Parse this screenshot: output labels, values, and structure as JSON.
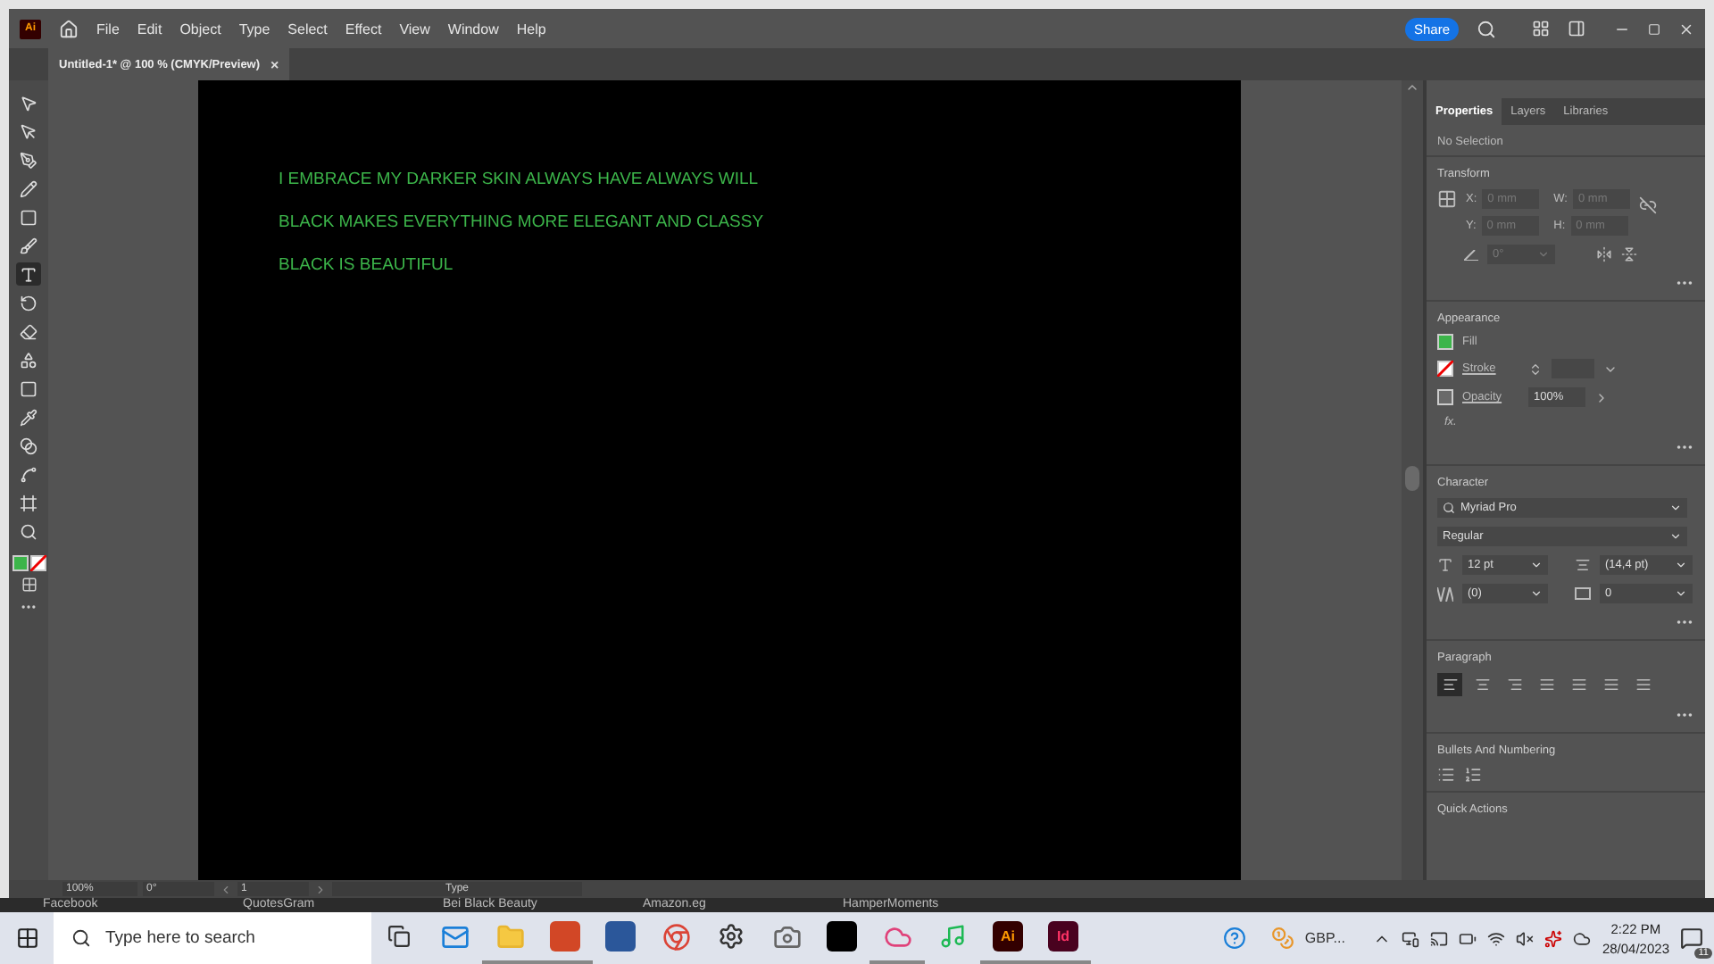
{
  "menu_bar": {
    "logo": "Ai",
    "items": [
      "File",
      "Edit",
      "Object",
      "Type",
      "Select",
      "Effect",
      "View",
      "Window",
      "Help"
    ],
    "share": "Share"
  },
  "document_tab": {
    "title": "Untitled-1* @ 100 % (CMYK/Preview)",
    "close": "×"
  },
  "tools": [
    {
      "kind": "selection",
      "selected": false
    },
    {
      "kind": "direct",
      "selected": false
    },
    {
      "kind": "pen",
      "selected": false
    },
    {
      "kind": "pencil",
      "selected": false
    },
    {
      "kind": "rectangle",
      "selected": false
    },
    {
      "kind": "brush",
      "selected": false
    },
    {
      "kind": "type",
      "selected": true
    },
    {
      "kind": "rotate",
      "selected": false
    },
    {
      "kind": "eraser",
      "selected": false
    },
    {
      "kind": "shape",
      "selected": false
    },
    {
      "kind": "gradient",
      "selected": false
    },
    {
      "kind": "eyedropper",
      "selected": false
    },
    {
      "kind": "blend",
      "selected": false
    },
    {
      "kind": "symbol",
      "selected": false
    },
    {
      "kind": "artboard",
      "selected": false
    },
    {
      "kind": "zoom",
      "selected": false
    }
  ],
  "toolbar_fill": {
    "color": "#3cb54a"
  },
  "artboard": {
    "lines": [
      "I EMBRACE MY DARKER SKIN ALWAYS HAVE ALWAYS WILL",
      "BLACK MAKES EVERYTHING MORE ELEGANT AND CLASSY",
      "BLACK IS BEAUTIFUL"
    ]
  },
  "status_bar": {
    "zoom": "100%",
    "rotation": "0°",
    "artboard": "1",
    "tool": "Type"
  },
  "bookmarks": [
    "Facebook",
    "QuotesGram",
    "Bei Black Beauty",
    "Amazon.eg",
    "HamperMoments"
  ],
  "panel": {
    "tabs": [
      {
        "label": "Properties",
        "selected": true
      },
      {
        "label": "Layers",
        "selected": false
      },
      {
        "label": "Libraries",
        "selected": false
      }
    ],
    "selection": "No Selection",
    "transform": {
      "title": "Transform",
      "fields": [
        {
          "label": "X:",
          "placeholder": "0 mm"
        },
        {
          "label": "W:",
          "placeholder": "0 mm"
        },
        {
          "label": "Y:",
          "placeholder": "0 mm"
        },
        {
          "label": "H:",
          "placeholder": "0 mm"
        }
      ],
      "angle_placeholder": "0°"
    },
    "appearance": {
      "title": "Appearance",
      "fill": {
        "label": "Fill",
        "color": "#3cb54a"
      },
      "stroke": {
        "label": "Stroke"
      },
      "opacity": {
        "label": "Opacity",
        "value": "100%"
      },
      "fx": "fx."
    },
    "character": {
      "title": "Character",
      "font": "Myriad Pro",
      "style": "Regular",
      "size": "12 pt",
      "leading": "(14,4 pt)",
      "kerning": "(0)",
      "tracking": "0"
    },
    "paragraph": {
      "title": "Paragraph",
      "alignments": [
        {
          "selected": true
        },
        {
          "selected": false
        },
        {
          "selected": false
        },
        {
          "selected": false
        },
        {
          "selected": false
        },
        {
          "selected": false
        },
        {
          "selected": false
        }
      ]
    },
    "bullets": {
      "title": "Bullets And Numbering"
    },
    "quick_actions": {
      "title": "Quick Actions"
    }
  },
  "taskbar": {
    "search_placeholder": "Type here to search",
    "apps": [
      {
        "kind": "taskview",
        "open": false
      },
      {
        "kind": "mail",
        "open": false
      },
      {
        "kind": "folder",
        "open": true
      },
      {
        "kind": "powerpoint",
        "open": true
      },
      {
        "kind": "word",
        "open": false
      },
      {
        "kind": "chrome",
        "open": false
      },
      {
        "kind": "settings",
        "open": false
      },
      {
        "kind": "camera",
        "open": false
      },
      {
        "kind": "netflix",
        "open": false
      },
      {
        "kind": "creative-cloud",
        "open": true
      },
      {
        "kind": "spotify",
        "open": false
      },
      {
        "kind": "illustrator",
        "label": "Ai",
        "open": true
      },
      {
        "kind": "indesign",
        "label": "Id",
        "open": true
      }
    ],
    "currency": "GBP...",
    "time": "2:22 PM",
    "date": "28/04/2023",
    "notifications": "11"
  }
}
